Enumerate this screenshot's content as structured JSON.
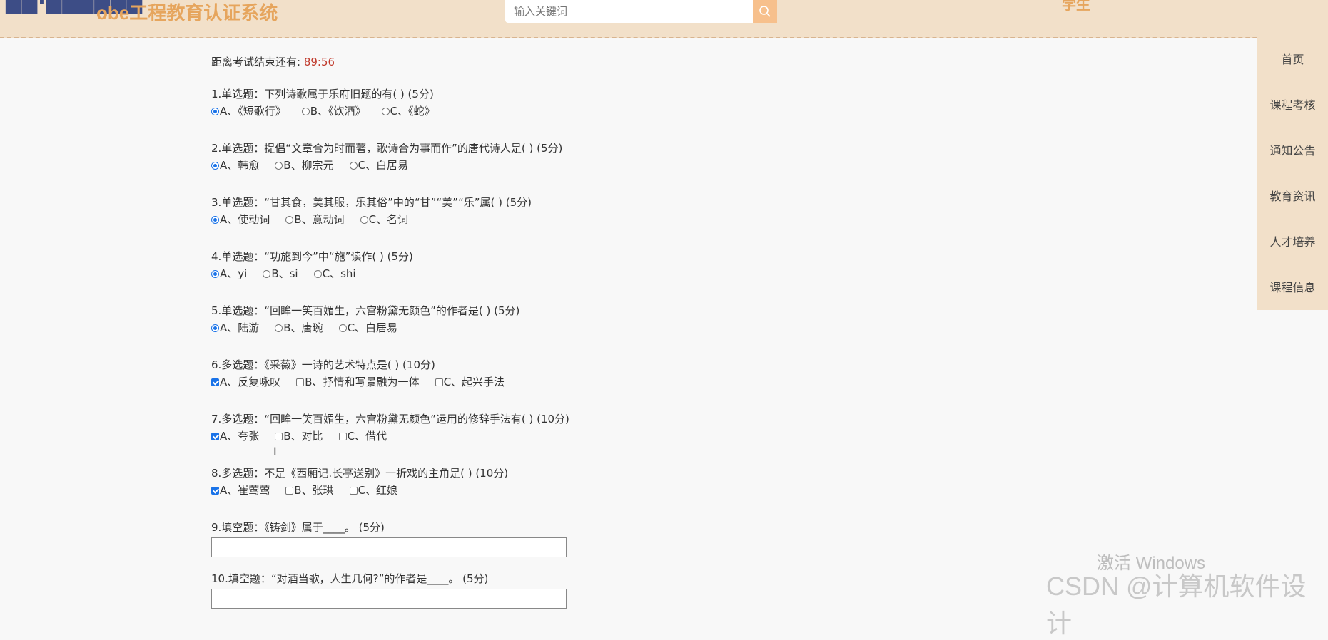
{
  "header": {
    "logo_sub": "obe工程教育认证系统",
    "search_placeholder": "输入关键词",
    "user_label": "学生"
  },
  "sidebar": {
    "items": [
      {
        "label": "首页"
      },
      {
        "label": "课程考核"
      },
      {
        "label": "通知公告"
      },
      {
        "label": "教育资讯"
      },
      {
        "label": "人才培养"
      },
      {
        "label": "课程信息"
      }
    ]
  },
  "exam": {
    "timer_label": "距离考试结束还有:",
    "timer_value": "89:56",
    "questions": [
      {
        "title": "1.单选题：下列诗歌属于乐府旧题的有( ) (5分)",
        "options": [
          "A、《短歌行》",
          "B、《饮酒》",
          "C、《蛇》"
        ]
      },
      {
        "title": "2.单选题：提倡“文章合为时而著，歌诗合为事而作”的唐代诗人是( ) (5分)",
        "options": [
          "A、韩愈",
          "B、柳宗元",
          "C、白居易"
        ]
      },
      {
        "title": "3.单选题：“甘其食，美其服，乐其俗”中的“甘”“美”“乐”属( ) (5分)",
        "options": [
          "A、使动词",
          "B、意动词",
          "C、名词"
        ]
      },
      {
        "title": "4.单选题：“功施到今”中“施”读作( ) (5分)",
        "options": [
          "A、yi",
          "B、si",
          "C、shi"
        ]
      },
      {
        "title": "5.单选题：“回眸一笑百媚生，六宫粉黛无颜色”的作者是( ) (5分)",
        "options": [
          "A、陆游",
          "B、唐琬",
          "C、白居易"
        ]
      },
      {
        "title": "6.多选题：《采薇》一诗的艺术特点是( ) (10分)",
        "options": [
          "A、反复咏叹",
          "B、抒情和写景融为一体",
          "C、起兴手法"
        ]
      },
      {
        "title": "7.多选题：“回眸一笑百媚生，六宫粉黛无颜色”运用的修辞手法有( ) (10分)",
        "options": [
          "A、夸张",
          "B、对比",
          "C、借代"
        ]
      },
      {
        "title": "8.多选题：不是《西厢记.长亭送别》一折戏的主角是( ) (10分)",
        "options": [
          "A、崔莺莺",
          "B、张珙",
          "C、红娘"
        ]
      },
      {
        "title": "9.填空题：《铸剑》属于____。 (5分)",
        "value": ""
      },
      {
        "title": "10.填空题：“对酒当歌，人生几何?”的作者是____。 (5分)",
        "value": ""
      }
    ]
  },
  "watermark": {
    "activate": "激活 Windows",
    "csdn": "CSDN @计算机软件设计"
  }
}
